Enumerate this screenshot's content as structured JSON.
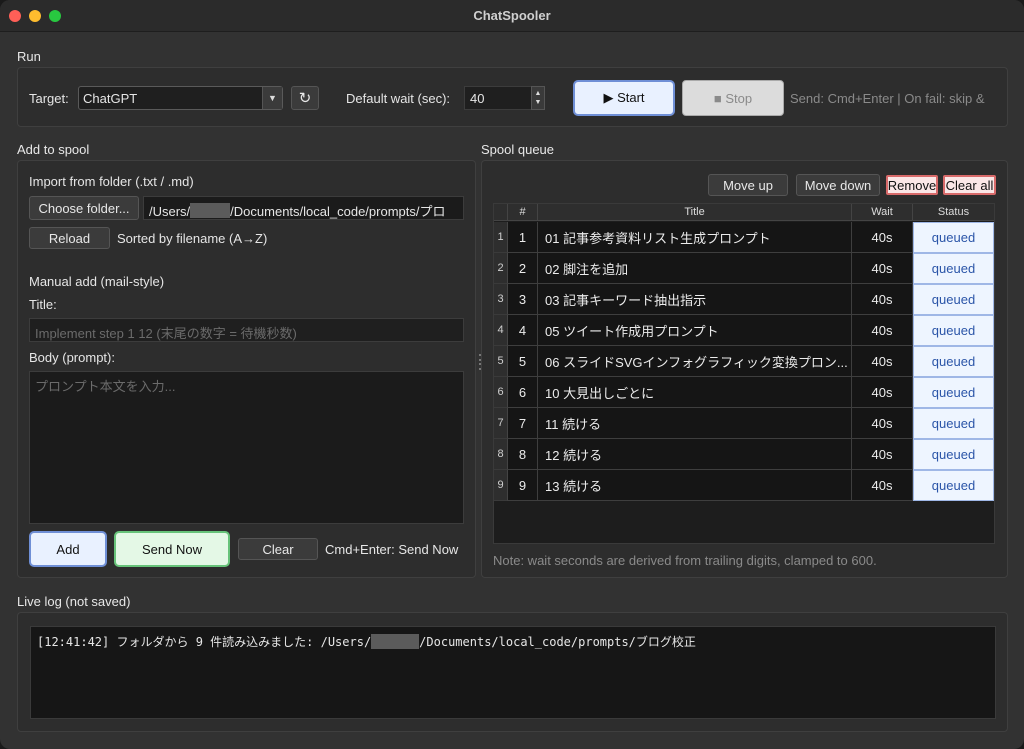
{
  "window": {
    "title": "ChatSpooler"
  },
  "run": {
    "section_label": "Run",
    "target_label": "Target:",
    "target_value": "ChatGPT",
    "default_wait_label": "Default wait (sec):",
    "default_wait_value": "40",
    "start_label": "▶ Start",
    "stop_label": "■ Stop",
    "hint": "Send: Cmd+Enter | On fail: skip &"
  },
  "add": {
    "section_label": "Add to spool",
    "import_label": "Import from folder (.txt / .md)",
    "choose_folder_label": "Choose folder...",
    "folder_path_prefix": "/Users/",
    "folder_path_suffix": "/Documents/local_code/prompts/プロ",
    "reload_label": "Reload",
    "sorted_label": "Sorted by filename (A→Z)",
    "manual_label": "Manual add (mail-style)",
    "title_label": "Title:",
    "title_placeholder": "Implement step 1 12  (末尾の数字 = 待機秒数)",
    "body_label": "Body (prompt):",
    "body_placeholder": "プロンプト本文を入力...",
    "add_button": "Add",
    "send_now_button": "Send Now",
    "clear_button": "Clear",
    "shortcut_hint": "Cmd+Enter: Send Now"
  },
  "queue": {
    "section_label": "Spool queue",
    "move_up": "Move up",
    "move_down": "Move down",
    "remove": "Remove",
    "clear_all": "Clear all",
    "columns": [
      "#",
      "Title",
      "Wait",
      "Status"
    ],
    "rows": [
      {
        "header": "1",
        "num": "1",
        "title": "01 記事参考資料リスト生成プロンプト",
        "wait": "40s",
        "status": "queued"
      },
      {
        "header": "2",
        "num": "2",
        "title": "02 脚注を追加",
        "wait": "40s",
        "status": "queued"
      },
      {
        "header": "3",
        "num": "3",
        "title": "03 記事キーワード抽出指示",
        "wait": "40s",
        "status": "queued"
      },
      {
        "header": "4",
        "num": "4",
        "title": "05 ツイート作成用プロンプト",
        "wait": "40s",
        "status": "queued"
      },
      {
        "header": "5",
        "num": "5",
        "title": "06 スライドSVGインフォグラフィック変換プロン...",
        "wait": "40s",
        "status": "queued"
      },
      {
        "header": "6",
        "num": "6",
        "title": "10 大見出しごとに",
        "wait": "40s",
        "status": "queued"
      },
      {
        "header": "7",
        "num": "7",
        "title": "11 続ける",
        "wait": "40s",
        "status": "queued"
      },
      {
        "header": "8",
        "num": "8",
        "title": "12 続ける",
        "wait": "40s",
        "status": "queued"
      },
      {
        "header": "9",
        "num": "9",
        "title": "13 続ける",
        "wait": "40s",
        "status": "queued"
      }
    ],
    "note": "Note: wait seconds are derived from trailing digits, clamped to 600."
  },
  "log": {
    "section_label": "Live log (not saved)",
    "line_prefix": "[12:41:42] フォルダから 9 件読み込みました: /Users/",
    "line_suffix": "/Documents/local_code/prompts/ブログ校正"
  }
}
